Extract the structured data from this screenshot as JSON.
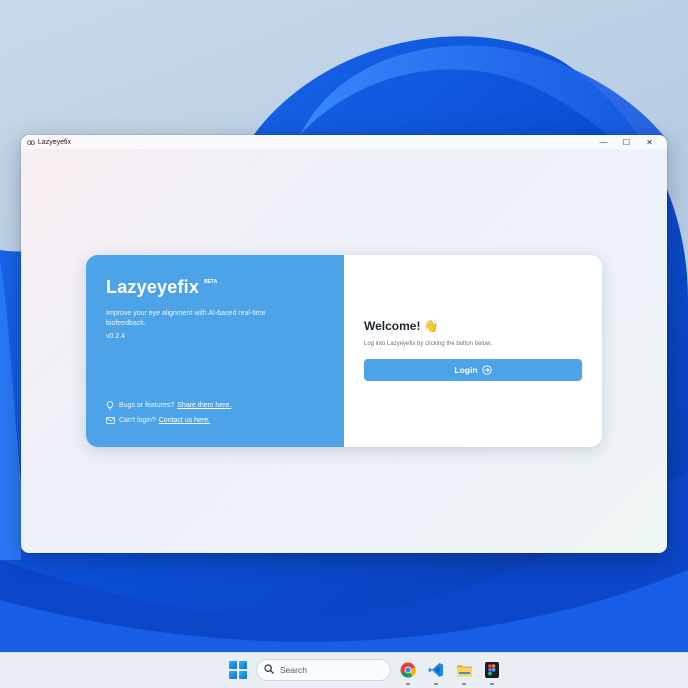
{
  "window": {
    "title": "Lazyeyefix",
    "controls": {
      "minimize": "—",
      "maximize": "☐",
      "close": "✕"
    }
  },
  "card": {
    "brand": "Lazyeyefix",
    "badge": "BETA",
    "tagline": "Improve your eye alignment with AI-based real-time biofeedback.",
    "version": "v0.2.4",
    "bugs_text": "Bugs or features?",
    "bugs_link": "Share them here.",
    "login_help_text": "Can't login?",
    "login_help_link": "Contact us here.",
    "welcome": "Welcome! 👋",
    "subtitle": "Log into Lazyeyefix by clicking the button below.",
    "login_label": "Login"
  },
  "taskbar": {
    "search_placeholder": "Search",
    "apps": [
      "chrome-icon",
      "vscode-icon",
      "file-explorer-icon",
      "figma-icon"
    ]
  },
  "colors": {
    "accent": "#4da3e8",
    "text_dark": "#1f2633",
    "text_muted": "#6b7280"
  }
}
